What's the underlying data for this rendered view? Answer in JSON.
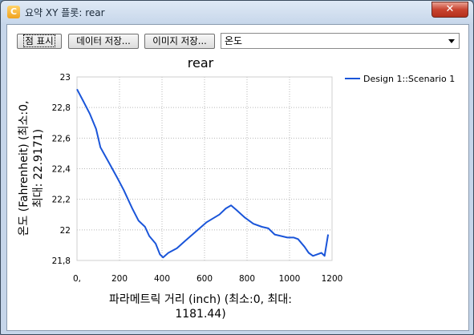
{
  "window": {
    "title": "요약 XY 플롯: rear",
    "app_icon_glyph": "C",
    "close_glyph": "✕"
  },
  "toolbar": {
    "points_button_label": "점 표시",
    "save_data_button_label": "데이터 저장...",
    "save_image_button_label": "이미지 저장...",
    "variable_select": {
      "selected": "온도"
    }
  },
  "chart_data": {
    "type": "line",
    "title": "rear",
    "xlabel_line1": "파라메트릭 거리 (inch) (최소:0, 최대:",
    "xlabel_line2": "1181.44)",
    "ylabel_line1": "온도 (Fahrenheit) (최소:0,",
    "ylabel_line2": "최대: 22.9171)",
    "xlim": [
      0,
      1200
    ],
    "ylim": [
      21.8,
      23
    ],
    "x_ticks": [
      "0,",
      "200",
      "400",
      "600",
      "800",
      "1000",
      "1200"
    ],
    "y_ticks": [
      "21,8",
      "22",
      "22,2",
      "22,4",
      "22,6",
      "22,8",
      "23"
    ],
    "grid": true,
    "legend_position": "right",
    "series": [
      {
        "name": "Design 1::Scenario 1",
        "color": "#1a55d9",
        "points": [
          [
            0,
            22.92
          ],
          [
            30,
            22.84
          ],
          [
            60,
            22.76
          ],
          [
            90,
            22.66
          ],
          [
            100,
            22.6
          ],
          [
            110,
            22.54
          ],
          [
            150,
            22.44
          ],
          [
            190,
            22.34
          ],
          [
            220,
            22.26
          ],
          [
            260,
            22.14
          ],
          [
            290,
            22.06
          ],
          [
            320,
            22.02
          ],
          [
            340,
            21.96
          ],
          [
            370,
            21.91
          ],
          [
            390,
            21.84
          ],
          [
            405,
            21.82
          ],
          [
            430,
            21.85
          ],
          [
            470,
            21.88
          ],
          [
            510,
            21.93
          ],
          [
            560,
            21.99
          ],
          [
            610,
            22.05
          ],
          [
            670,
            22.1
          ],
          [
            700,
            22.14
          ],
          [
            725,
            22.16
          ],
          [
            750,
            22.13
          ],
          [
            790,
            22.08
          ],
          [
            830,
            22.04
          ],
          [
            870,
            22.02
          ],
          [
            900,
            22.01
          ],
          [
            930,
            21.97
          ],
          [
            960,
            21.96
          ],
          [
            990,
            21.95
          ],
          [
            1020,
            21.95
          ],
          [
            1040,
            21.94
          ],
          [
            1070,
            21.89
          ],
          [
            1090,
            21.85
          ],
          [
            1110,
            21.83
          ],
          [
            1130,
            21.84
          ],
          [
            1150,
            21.85
          ],
          [
            1165,
            21.83
          ],
          [
            1181.44,
            21.97
          ]
        ]
      }
    ]
  }
}
